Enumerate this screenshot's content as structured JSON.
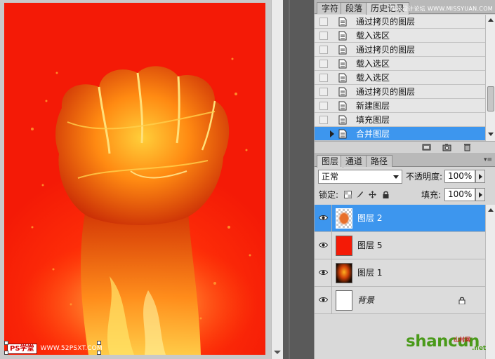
{
  "canvas": {
    "watermark_logo": "PS学堂",
    "watermark_url": "WWW.52PSXT.COM"
  },
  "history_panel": {
    "tabs": [
      {
        "label": "字符",
        "active": false
      },
      {
        "label": "段落",
        "active": false
      },
      {
        "label": "历史记录",
        "active": true
      }
    ],
    "site_text": "思缘设计论坛 WWW.MISSYUAN.COM",
    "items": [
      {
        "label": "通过拷贝的图层",
        "selected": false
      },
      {
        "label": "载入选区",
        "selected": false
      },
      {
        "label": "通过拷贝的图层",
        "selected": false
      },
      {
        "label": "载入选区",
        "selected": false
      },
      {
        "label": "载入选区",
        "selected": false
      },
      {
        "label": "通过拷贝的图层",
        "selected": false
      },
      {
        "label": "新建图层",
        "selected": false
      },
      {
        "label": "填充图层",
        "selected": false
      },
      {
        "label": "合并图层",
        "selected": true
      }
    ]
  },
  "layers_panel": {
    "tabs": [
      {
        "label": "图层",
        "active": true
      },
      {
        "label": "通道",
        "active": false
      },
      {
        "label": "路径",
        "active": false
      }
    ],
    "menu_glyph": "▾≡",
    "blend_mode": "正常",
    "opacity_label": "不透明度:",
    "opacity_value": "100%",
    "lock_label": "锁定:",
    "fill_label": "填充:",
    "fill_value": "100%",
    "layers": [
      {
        "name": "图层 2",
        "thumb": "fist-transparent",
        "selected": true,
        "locked": false,
        "italic": false
      },
      {
        "name": "图层 5",
        "thumb": "red-fill",
        "selected": false,
        "locked": false,
        "italic": false
      },
      {
        "name": "图层 1",
        "thumb": "fist-dark",
        "selected": false,
        "locked": false,
        "italic": false
      },
      {
        "name": "背景",
        "thumb": "white-fill",
        "selected": false,
        "locked": true,
        "italic": true
      }
    ]
  },
  "brand": {
    "text": "shancun",
    "tag": "山村网",
    "net": ".net"
  },
  "colors": {
    "canvas_red": "#f41a06",
    "selection_blue": "#3d96ee",
    "brand_green": "#4a9a1a"
  }
}
